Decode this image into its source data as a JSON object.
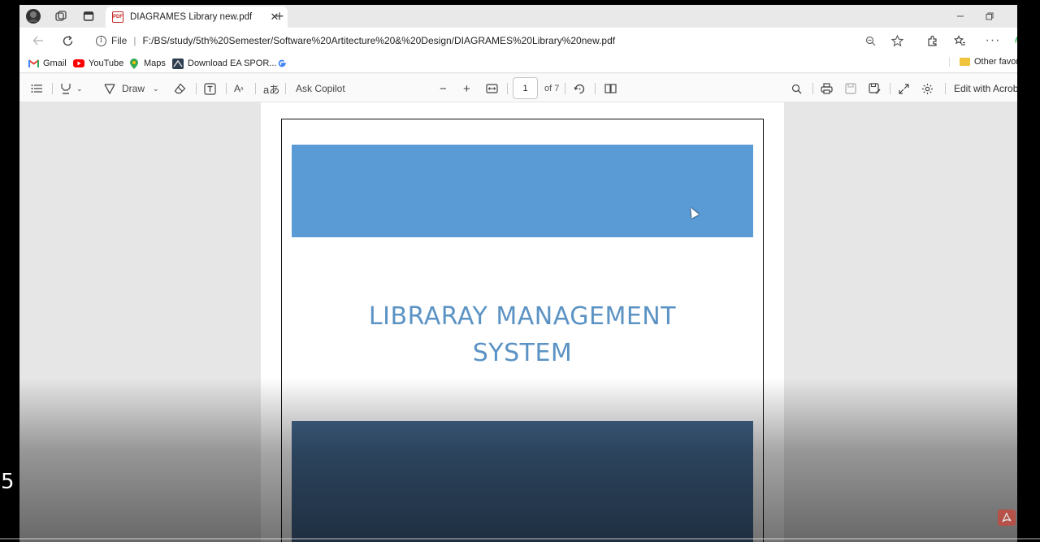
{
  "tab": {
    "title": "DIAGRAMES Library new.pdf",
    "close": "✕",
    "new_tab": "+"
  },
  "address": {
    "file_label": "File",
    "separator": "|",
    "url": "F:/BS/study/5th%20Semester/Software%20Artitecture%20&%20Design/DIAGRAMES%20Library%20new.pdf"
  },
  "bookmarks": [
    {
      "label": "Gmail",
      "icon": "gmail-icon"
    },
    {
      "label": "YouTube",
      "icon": "youtube-icon"
    },
    {
      "label": "Maps",
      "icon": "maps-icon"
    },
    {
      "label": "Download EA SPOR...",
      "icon": "ea-icon"
    },
    {
      "label": "",
      "icon": "google-icon"
    }
  ],
  "bookmarks_other": "Other favorit",
  "pdf_toolbar": {
    "draw_label": "Draw",
    "ask_copilot": "Ask Copilot",
    "zoom_out": "−",
    "zoom_in": "+",
    "page_current": "1",
    "page_total": "of 7",
    "edit_with": "Edit with Acroba"
  },
  "document": {
    "title_line1": "LIBRARAY MANAGEMENT",
    "title_line2": "SYSTEM"
  },
  "overlay": {
    "number": "5"
  },
  "colors": {
    "top_band": "#5b9bd5",
    "bottom_band": "#44688f",
    "title": "#5b93c4"
  }
}
